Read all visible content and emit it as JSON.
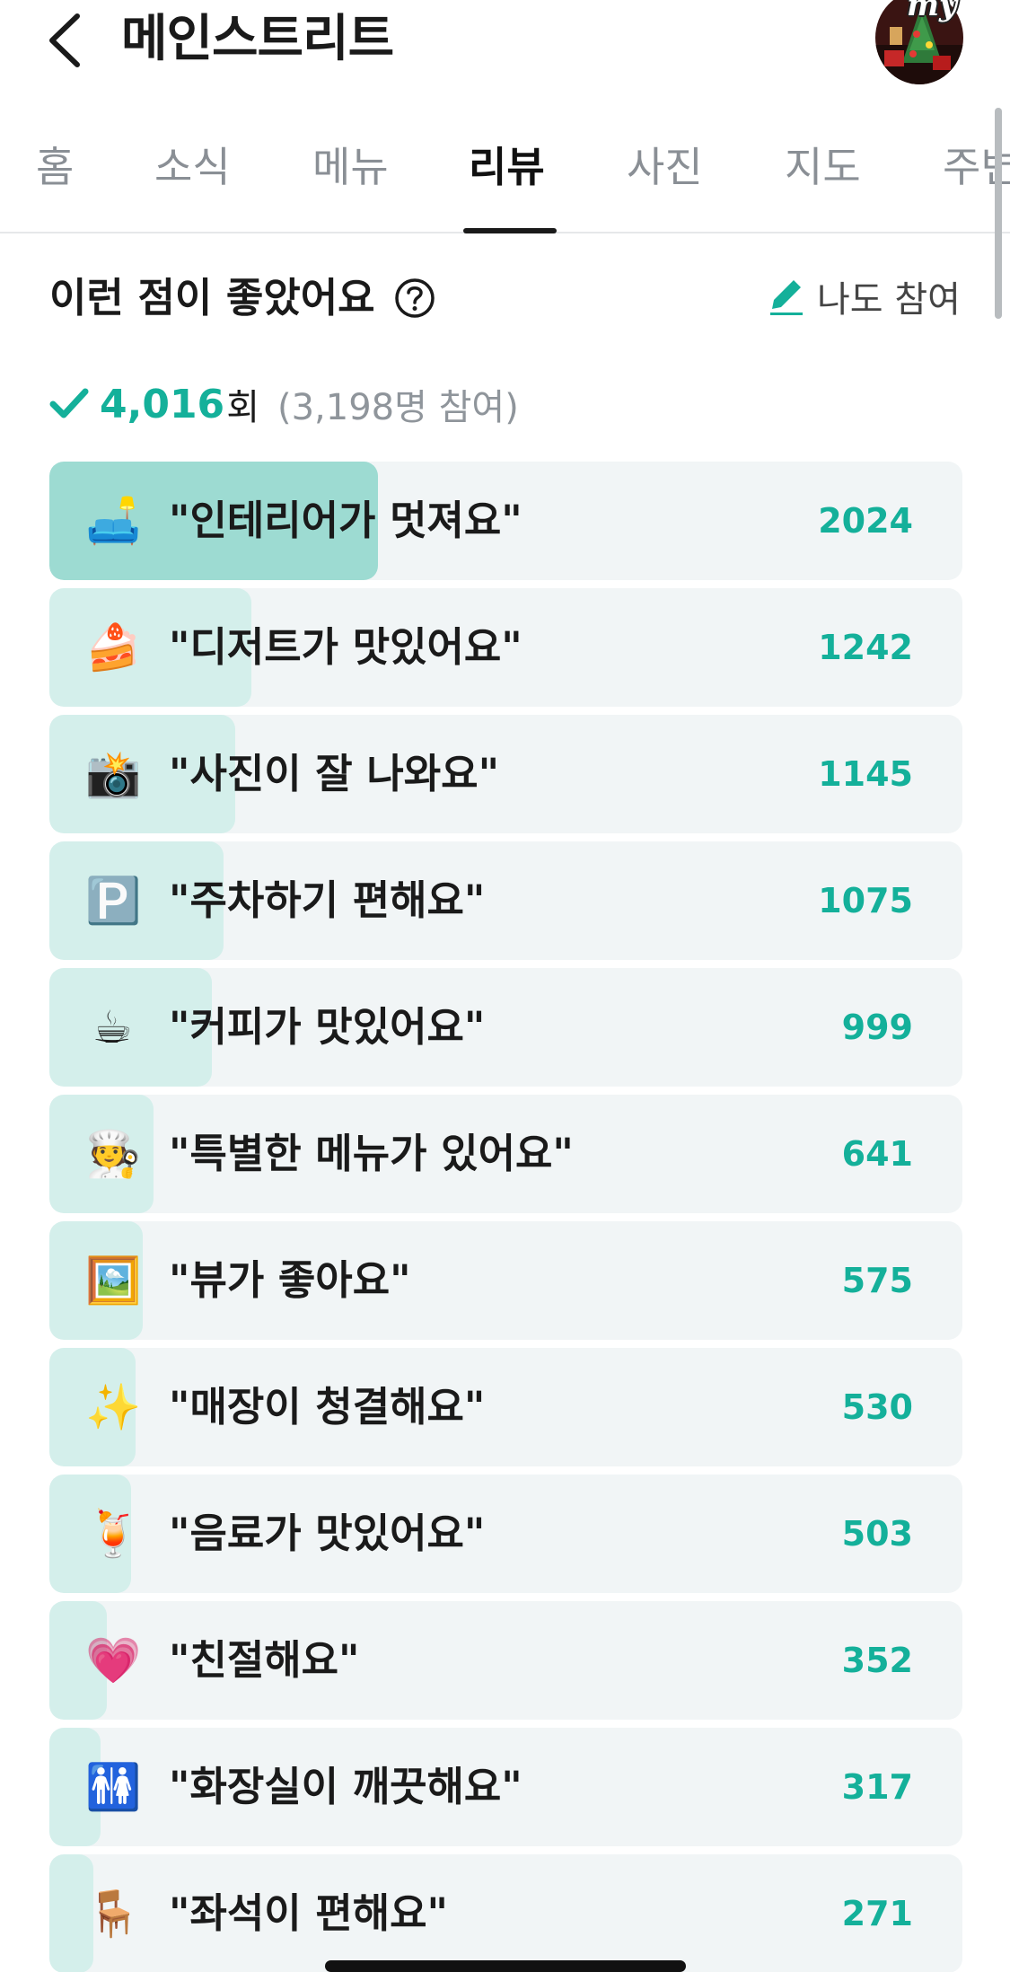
{
  "header": {
    "title": "메인스트리트",
    "profile_tag": "my"
  },
  "tabs": [
    {
      "label": "홈",
      "active": false
    },
    {
      "label": "소식",
      "active": false
    },
    {
      "label": "메뉴",
      "active": false
    },
    {
      "label": "리뷰",
      "active": true
    },
    {
      "label": "사진",
      "active": false
    },
    {
      "label": "지도",
      "active": false
    },
    {
      "label": "주변",
      "active": false
    }
  ],
  "section": {
    "title": "이런 점이 좋았어요",
    "join_label": "나도 참여",
    "total_count": "4,016",
    "count_unit": "회",
    "participants": "(3,198명 참여)"
  },
  "colors": {
    "accent": "#14b09a",
    "fill_top": "#9ddbd2",
    "fill": "#d4efeb",
    "row_bg": "#f1f5f6"
  },
  "reviews": [
    {
      "icon": "sofa-icon",
      "emoji": "🛋️",
      "label": "\"인테리어가 멋져요\"",
      "count": "2024",
      "ratio": 1.0
    },
    {
      "icon": "cake-icon",
      "emoji": "🍰",
      "label": "\"디저트가 맛있어요\"",
      "count": "1242",
      "ratio": 0.614
    },
    {
      "icon": "camera-flash-icon",
      "emoji": "📸",
      "label": "\"사진이 잘 나와요\"",
      "count": "1145",
      "ratio": 0.566
    },
    {
      "icon": "parking-icon",
      "emoji": "🅿️",
      "label": "\"주차하기 편해요\"",
      "count": "1075",
      "ratio": 0.531
    },
    {
      "icon": "coffee-icon",
      "emoji": "☕",
      "label": "\"커피가 맛있어요\"",
      "count": "999",
      "ratio": 0.494
    },
    {
      "icon": "chef-icon",
      "emoji": "🧑‍🍳",
      "label": "\"특별한 메뉴가 있어요\"",
      "count": "641",
      "ratio": 0.317
    },
    {
      "icon": "framed-picture-icon",
      "emoji": "🖼️",
      "label": "\"뷰가 좋아요\"",
      "count": "575",
      "ratio": 0.284
    },
    {
      "icon": "sparkles-icon",
      "emoji": "✨",
      "label": "\"매장이 청결해요\"",
      "count": "530",
      "ratio": 0.262
    },
    {
      "icon": "tropical-drink-icon",
      "emoji": "🍹",
      "label": "\"음료가 맛있어요\"",
      "count": "503",
      "ratio": 0.248
    },
    {
      "icon": "heart-face-icon",
      "emoji": "💗",
      "label": "\"친절해요\"",
      "count": "352",
      "ratio": 0.174
    },
    {
      "icon": "restroom-icon",
      "emoji": "🚻",
      "label": "\"화장실이 깨끗해요\"",
      "count": "317",
      "ratio": 0.157
    },
    {
      "icon": "seat-icon",
      "emoji": "🪑",
      "label": "\"좌석이 편해요\"",
      "count": "271",
      "ratio": 0.134
    }
  ]
}
